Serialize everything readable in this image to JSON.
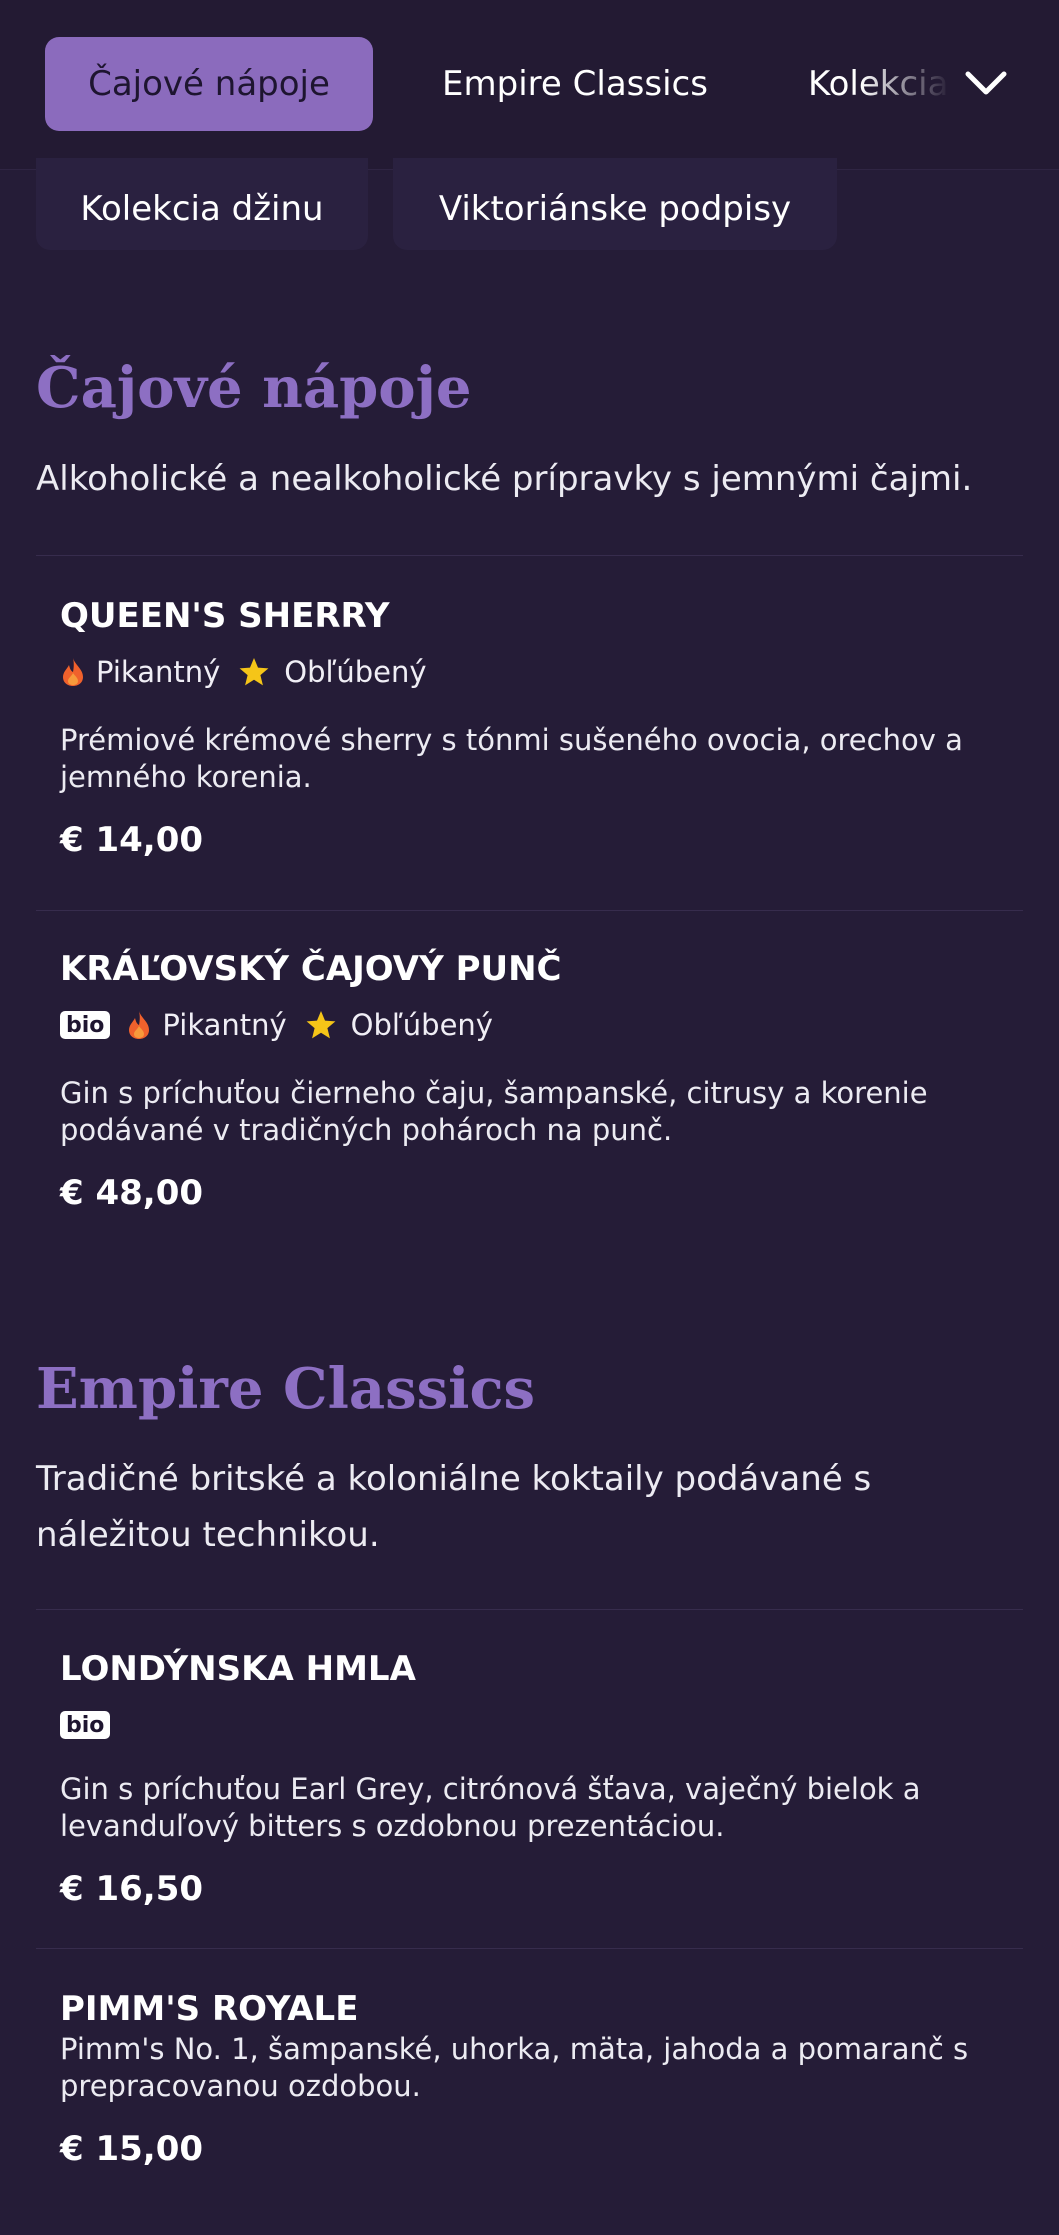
{
  "nav": {
    "tabs": [
      {
        "label": "Čajové nápoje",
        "active": true
      },
      {
        "label": "Empire Classics",
        "active": false
      },
      {
        "label": "Kolekcia džinu",
        "active": false
      }
    ],
    "dropdown_icon": "chevron-down-icon",
    "overflow": [
      {
        "label": "Kolekcia džinu"
      },
      {
        "label": "Viktoriánske podpisy"
      }
    ]
  },
  "colors": {
    "background": "#251c37",
    "accent": "#8b6bbd",
    "heading": "#8d6fc3",
    "flame": "#f0612c",
    "star": "#f5c518"
  },
  "tag_labels": {
    "spicy": "Pikantný",
    "favorite": "Obľúbený",
    "bio": "bio"
  },
  "sections": [
    {
      "title": "Čajové nápoje",
      "description": "Alkoholické a nealkoholické prípravky s jemnými čajmi.",
      "items": [
        {
          "name": "QUEEN'S SHERRY",
          "description": "Prémiové krémové sherry s tónmi sušeného ovocia, orechov a jemného korenia.",
          "price": "€ 14,00"
        },
        {
          "name": "KRÁĽOVSKÝ ČAJOVÝ PUNČ",
          "description": "Gin s príchuťou čierneho čaju, šampanské, citrusy a korenie podávané v tradičných pohároch na punč.",
          "price": "€ 48,00"
        }
      ]
    },
    {
      "title": "Empire Classics",
      "description": "Tradičné britské a koloniálne koktaily podávané s náležitou technikou.",
      "items": [
        {
          "name": "LONDÝNSKA HMLA",
          "description": "Gin s príchuťou Earl Grey, citrónová šťava, vaječný bielok a levanduľový bitters s ozdobnou prezentáciou.",
          "price": "€ 16,50"
        },
        {
          "name": "PIMM'S ROYALE",
          "description": "Pimm's No. 1, šampanské, uhorka, mäta, jahoda a pomaranč s prepracovanou ozdobou.",
          "price": "€ 15,00"
        }
      ]
    }
  ]
}
